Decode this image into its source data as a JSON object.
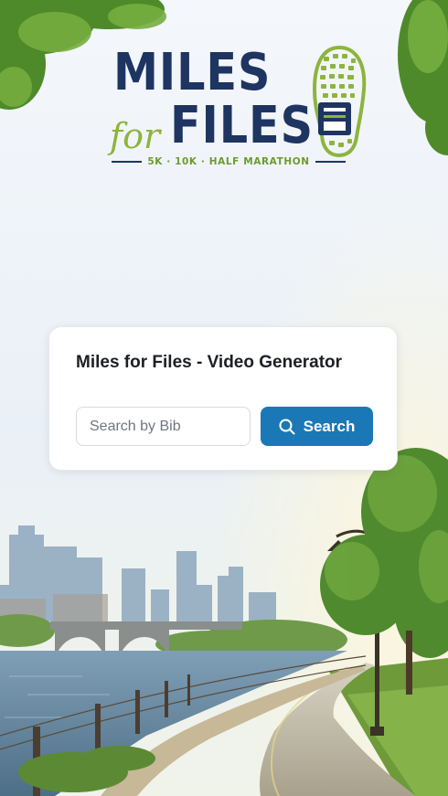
{
  "logo": {
    "line1": "MILES",
    "line2_script": "for",
    "line2": "FILES",
    "tagline": "5K · 10K · HALF MARATHON",
    "icon": "shoe-print-file-icon"
  },
  "card": {
    "title": "Miles for Files - Video Generator",
    "search_placeholder": "Search by Bib",
    "search_value": "",
    "search_button_label": "Search",
    "search_button_icon": "search-icon"
  },
  "colors": {
    "brand_navy": "#1e3461",
    "brand_green": "#8db43e",
    "button_blue": "#1b78b6"
  }
}
